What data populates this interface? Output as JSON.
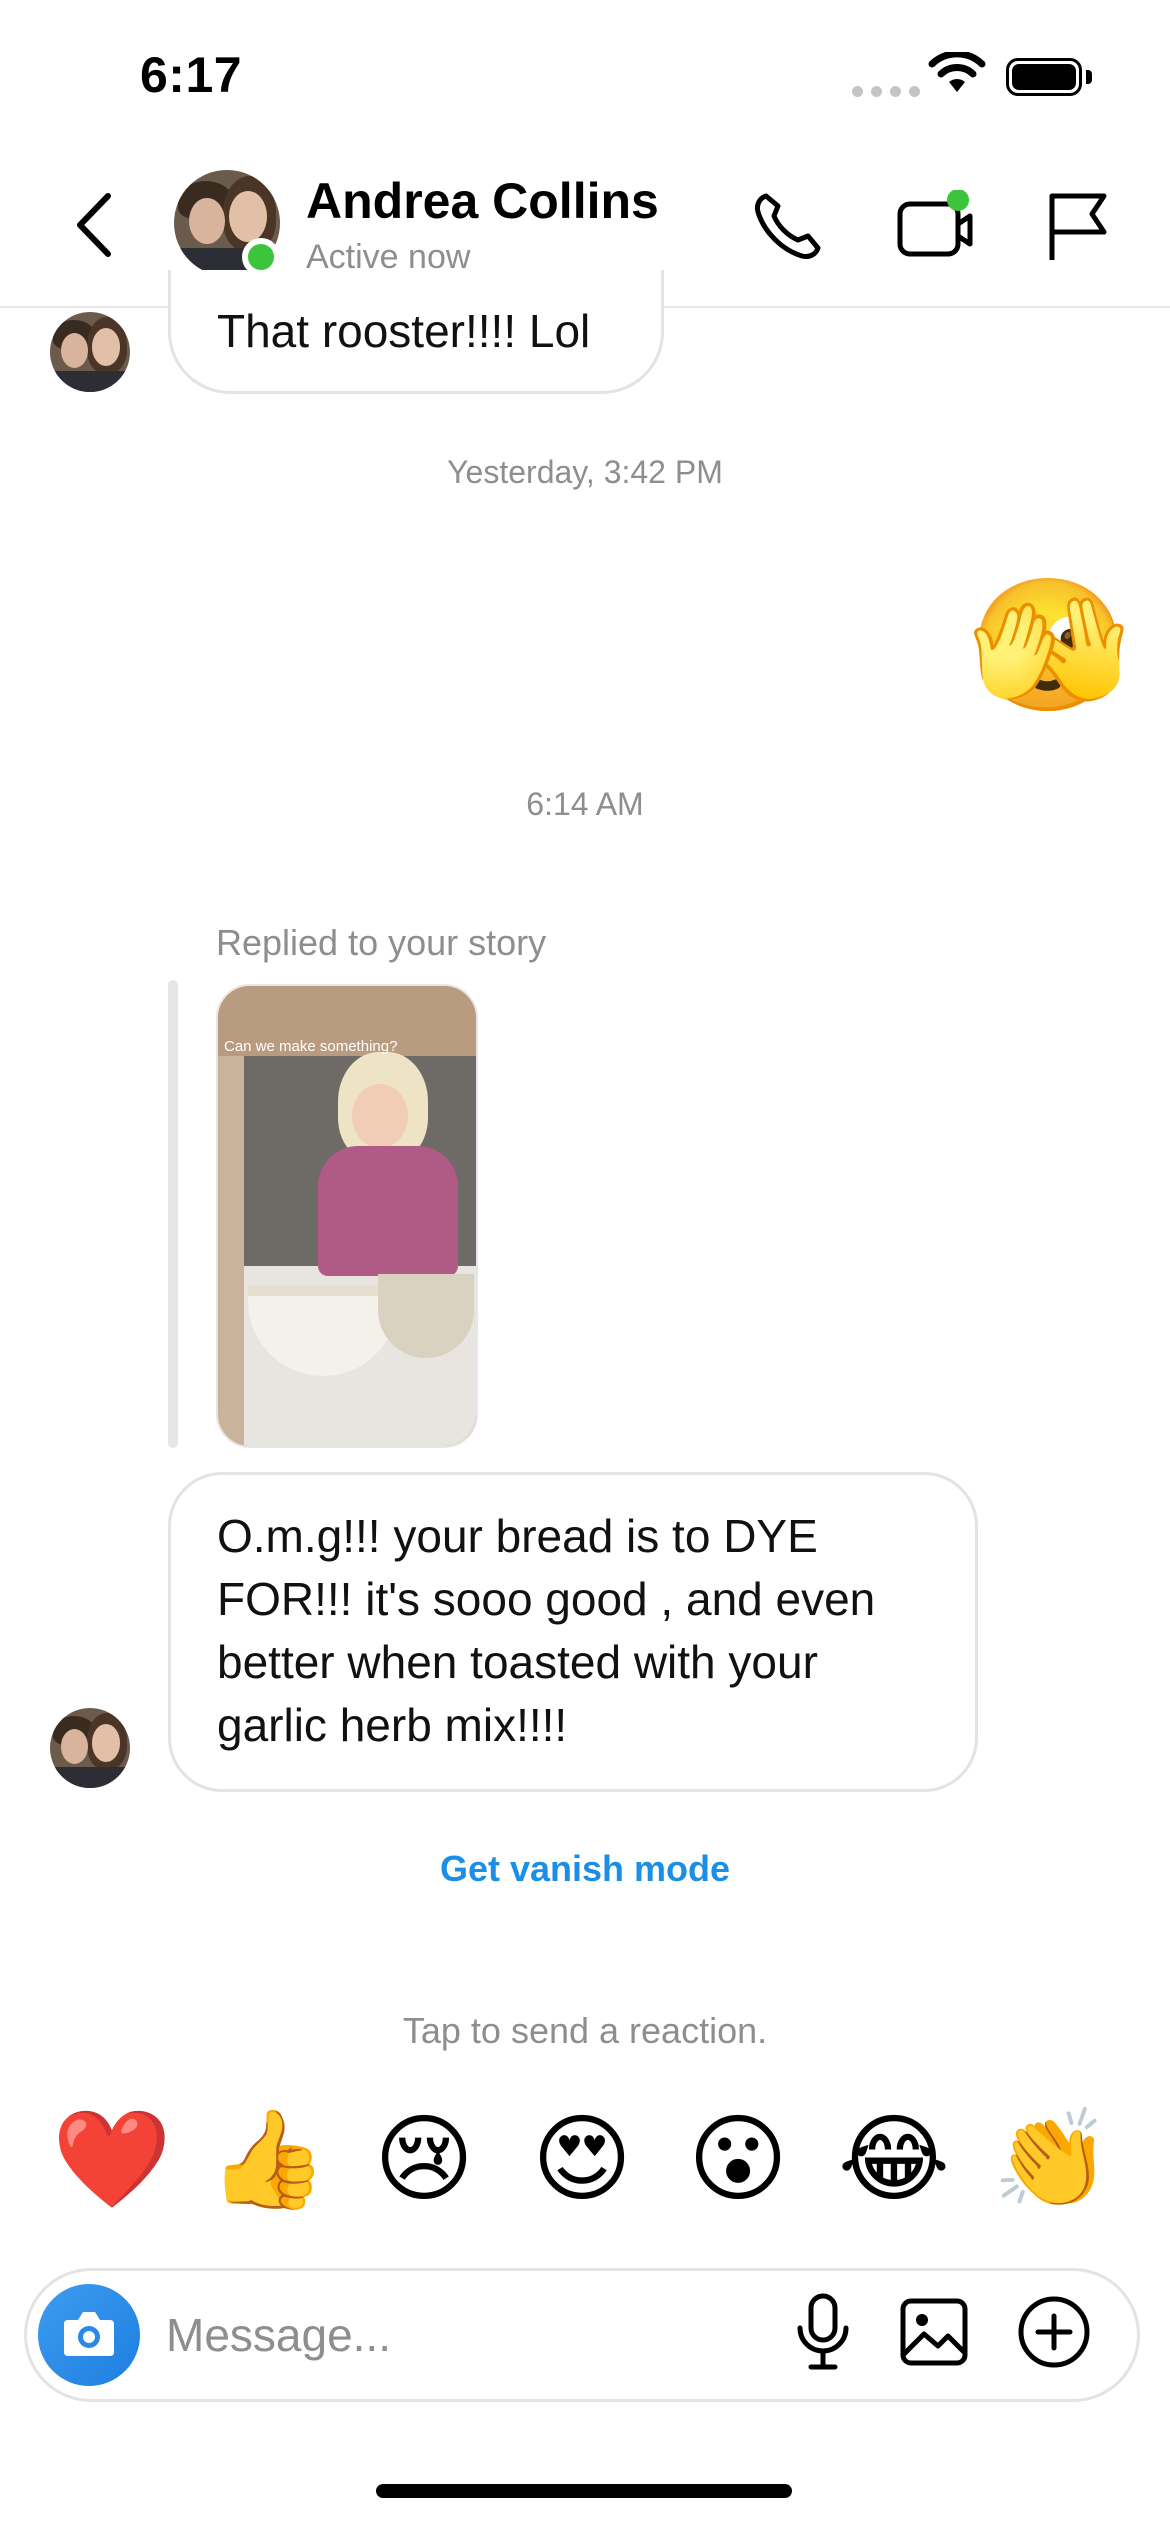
{
  "status_bar": {
    "time": "6:17"
  },
  "header": {
    "name": "Andrea Collins",
    "status": "Active now"
  },
  "messages": {
    "m1_text": "That rooster!!!! Lol",
    "timestamp1": "Yesterday, 3:42 PM",
    "emoji_sent": "🫣",
    "timestamp2": "6:14 AM",
    "reply_label": "Replied to your story",
    "story_caption": "Can we make something?",
    "m2_lines": [
      "O.m.g!!! your bread is to DYE",
      "FOR!!!  it's sooo good , and even",
      "better  when toasted with your",
      "garlic herb mix!!!!"
    ]
  },
  "vanish_mode": "Get vanish mode",
  "reaction_prompt": "Tap to send a reaction.",
  "reactions": [
    "❤️",
    "👍",
    "😢",
    "😍",
    "😮",
    "😂",
    "👏"
  ],
  "composer": {
    "placeholder": "Message..."
  },
  "colors": {
    "accent": "#1b8fe6",
    "online": "#3cc43c"
  }
}
